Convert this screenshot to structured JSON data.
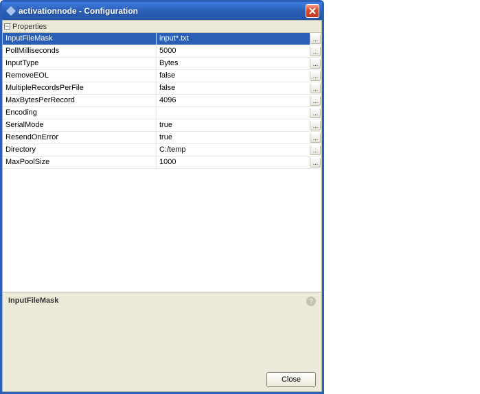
{
  "window": {
    "title": "activationnode - Configuration"
  },
  "properties": {
    "header": "Properties",
    "selected_index": 0,
    "rows": [
      {
        "name": "InputFileMask",
        "value": "input*.txt"
      },
      {
        "name": "PollMilliseconds",
        "value": "5000"
      },
      {
        "name": "InputType",
        "value": "Bytes"
      },
      {
        "name": "RemoveEOL",
        "value": "false"
      },
      {
        "name": "MultipleRecordsPerFile",
        "value": "false"
      },
      {
        "name": "MaxBytesPerRecord",
        "value": "4096"
      },
      {
        "name": "Encoding",
        "value": ""
      },
      {
        "name": "SerialMode",
        "value": "true"
      },
      {
        "name": "ResendOnError",
        "value": "true"
      },
      {
        "name": "Directory",
        "value": "C:/temp"
      },
      {
        "name": "MaxPoolSize",
        "value": "1000"
      }
    ]
  },
  "description": {
    "title": "InputFileMask"
  },
  "buttons": {
    "close": "Close"
  },
  "glyphs": {
    "expander": "−",
    "ellipsis": "...",
    "help": "?"
  }
}
